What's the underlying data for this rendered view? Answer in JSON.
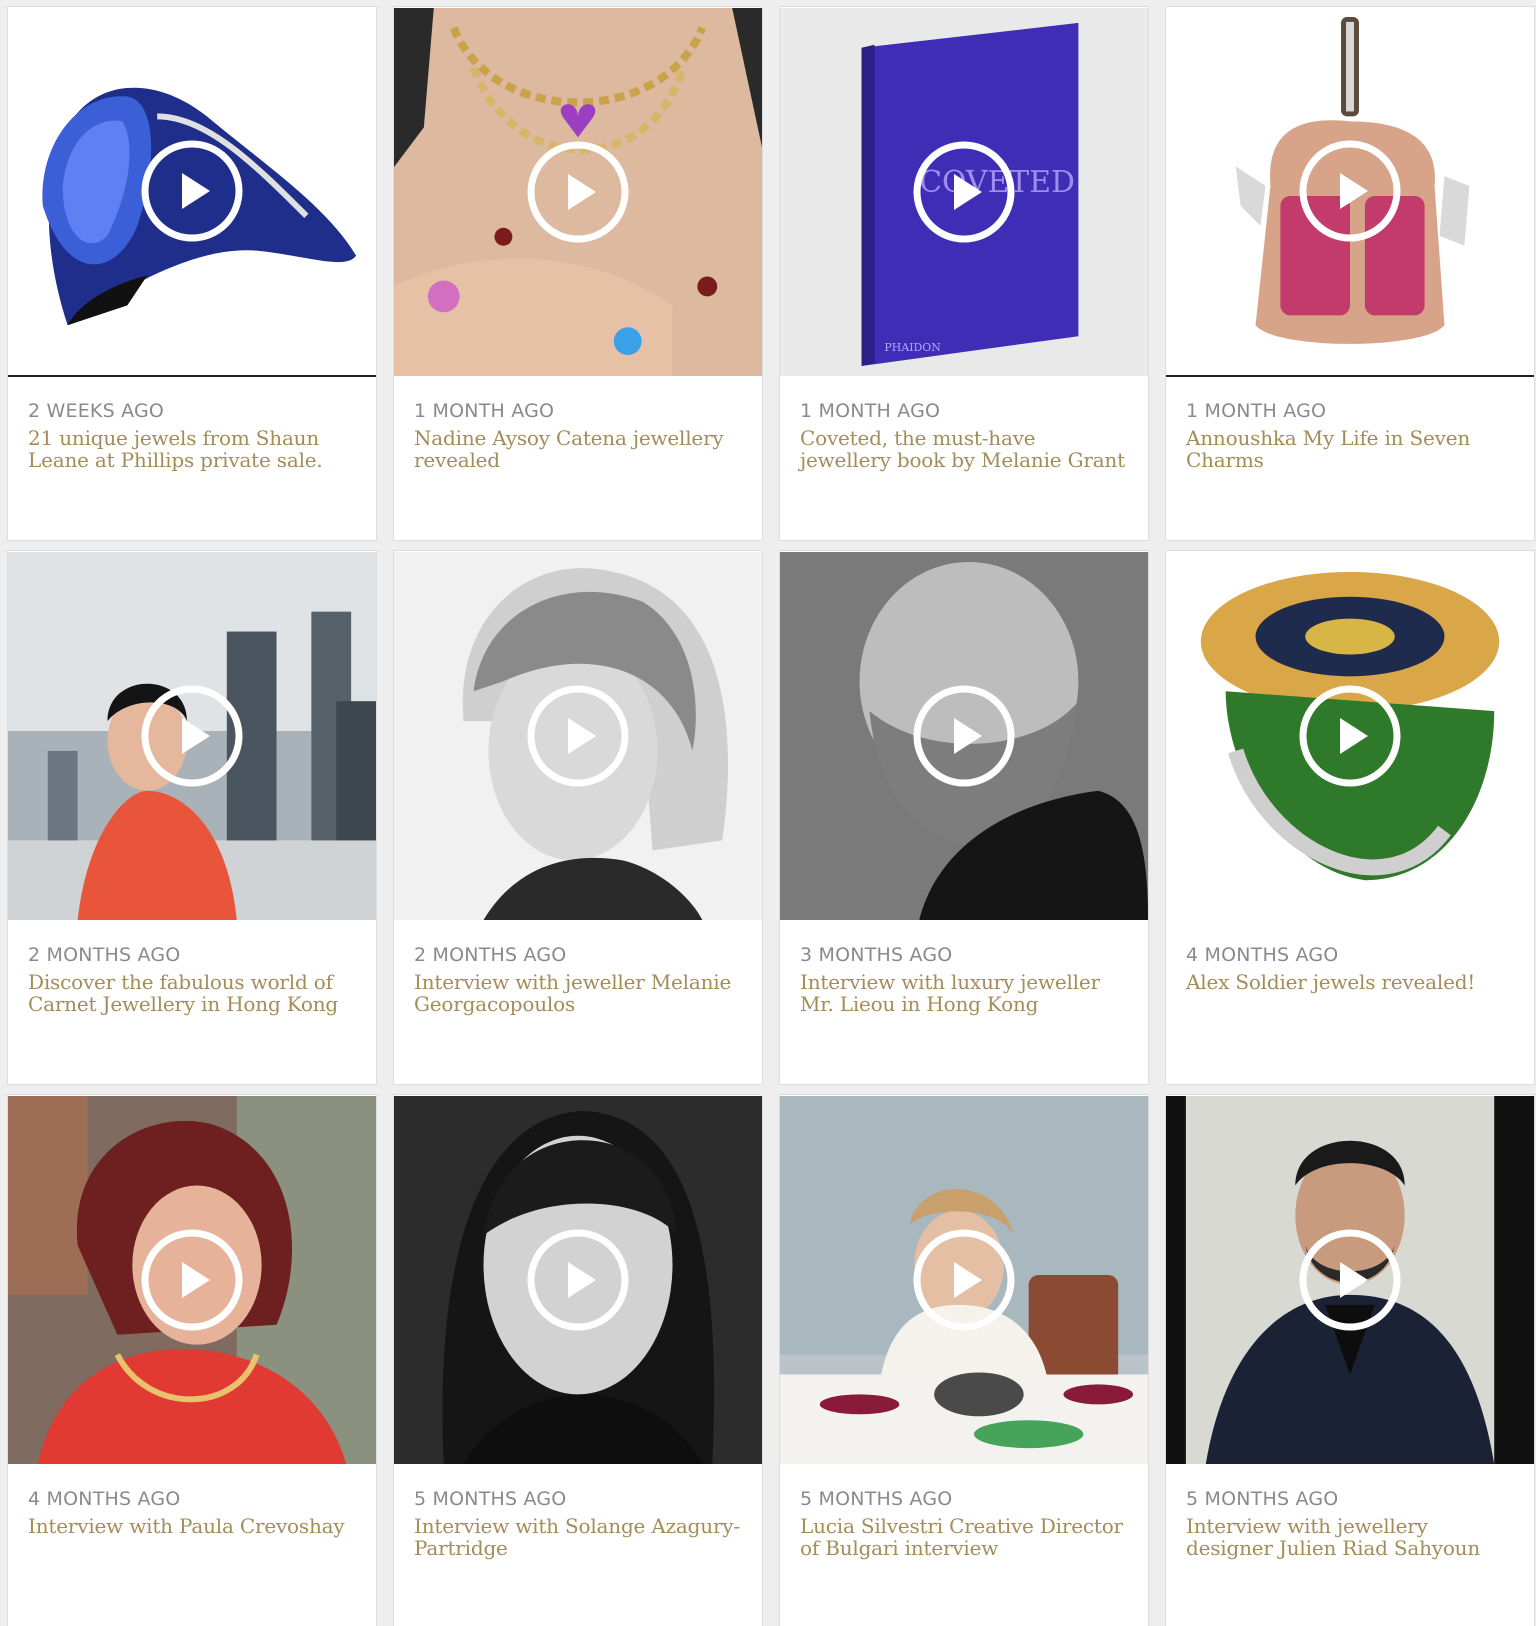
{
  "cards": [
    {
      "ago": "2 WEEKS AGO",
      "title": "21 unique jewels from Shaun Leane at Phillips private sale.",
      "image": "blue-sapphire-ring"
    },
    {
      "ago": "1 MONTH AGO",
      "title": "Nadine Aysoy Catena jewellery revealed",
      "image": "gold-chain-necklaces"
    },
    {
      "ago": "1 MONTH AGO",
      "title": "Coveted, the must-have jewellery book by Melanie Grant",
      "image": "purple-book-coveted"
    },
    {
      "ago": "1 MONTH AGO",
      "title": "Annoushka My Life in Seven Charms",
      "image": "ruby-charm-pendant"
    },
    {
      "ago": "2 MONTHS AGO",
      "title": "Discover the fabulous world of Carnet Jewellery in Hong Kong",
      "image": "woman-hong-kong-skyline"
    },
    {
      "ago": "2 MONTHS AGO",
      "title": "Interview with jeweller Melanie Georgacopoulos",
      "image": "blonde-woman-portrait"
    },
    {
      "ago": "3 MONTHS AGO",
      "title": "Interview with luxury jeweller Mr. Lieou in Hong Kong",
      "image": "bald-man-portrait"
    },
    {
      "ago": "4 MONTHS AGO",
      "title": "Alex Soldier jewels revealed!",
      "image": "sunflower-ring"
    },
    {
      "ago": "4 MONTHS AGO",
      "title": "Interview with Paula Crevoshay",
      "image": "red-haired-woman-portrait"
    },
    {
      "ago": "5 MONTHS AGO",
      "title": "Interview with Solange Azagury-Partridge",
      "image": "dark-haired-woman-portrait"
    },
    {
      "ago": "5 MONTHS AGO",
      "title": "Lucia Silvestri Creative Director of Bulgari interview",
      "image": "woman-with-gemstones"
    },
    {
      "ago": "5 MONTHS AGO",
      "title": "Interview with jewellery designer Julien Riad Sahyoun",
      "image": "bearded-man-portrait"
    }
  ],
  "book_cover_text": "COVETED",
  "book_publisher": "PHAIDON",
  "icons": {
    "play": "play-icon"
  },
  "colors": {
    "title": "#a48c58",
    "ago": "#8a8a8a",
    "background": "#eeeeee"
  }
}
